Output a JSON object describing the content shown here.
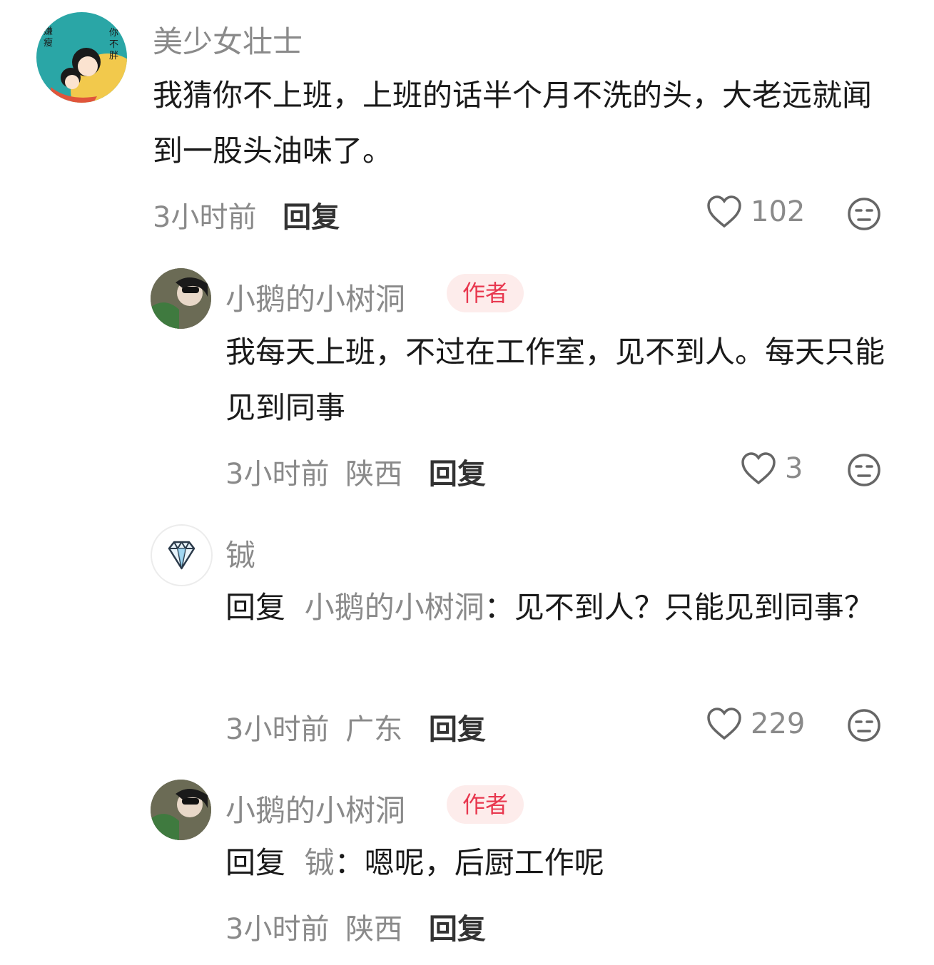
{
  "comments": [
    {
      "name": "美少女壮士",
      "avatar_text_left": "嫌瘦",
      "avatar_text_right": "你不胖",
      "text": "我猜你不上班，上班的话半个月不洗的头，大老远就闻到一股头油味了。",
      "time": "3小时前",
      "reply_label": "回复",
      "likes": "102",
      "heart_icon": "heart-outline-icon",
      "dislike_icon": "meh-face-icon"
    },
    {
      "name": "小鹅的小树洞",
      "badge": "作者",
      "text": "我每天上班，不过在工作室，见不到人。每天只能见到同事",
      "time": "3小时前",
      "location": "陕西",
      "reply_label": "回复",
      "likes": "3"
    },
    {
      "name": "铖",
      "avatar_icon": "diamond-icon",
      "reply_prefix": "回复",
      "reply_target": "小鹅的小树洞",
      "text": "：见不到人？只能见到同事？",
      "time": "3小时前",
      "location": "广东",
      "reply_label": "回复",
      "likes": "229"
    },
    {
      "name": "小鹅的小树洞",
      "badge": "作者",
      "reply_prefix": "回复",
      "reply_target": "铖",
      "text": "：嗯呢，后厨工作呢",
      "time": "3小时前",
      "location": "陕西",
      "reply_label": "回复"
    }
  ],
  "colors": {
    "badge_bg": "#fdeceb",
    "badge_text": "#e8384f",
    "muted": "#8a8a8a"
  }
}
